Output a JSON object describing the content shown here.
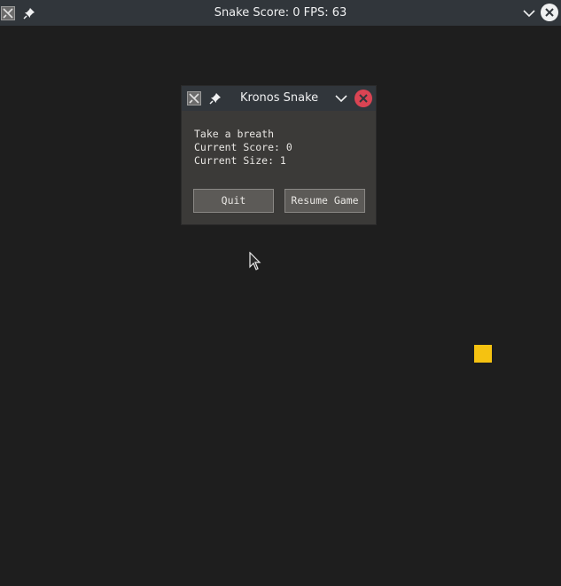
{
  "window": {
    "title": "Snake Score: 0 FPS: 63",
    "icons": [
      "app-icon",
      "pin-icon",
      "chevron-down-icon",
      "close-icon"
    ]
  },
  "dialog": {
    "title": "Kronos Snake",
    "lines": [
      "Take a breath",
      "Current Score: 0",
      "Current Size: 1"
    ],
    "buttons": {
      "quit": "Quit",
      "resume": "Resume Game"
    },
    "icons": [
      "app-icon",
      "pin-icon",
      "chevron-down-icon",
      "close-icon"
    ]
  },
  "game": {
    "score": 0,
    "fps": 63,
    "snake_size": 1,
    "food_color": "#f5c211",
    "background_color": "#1e1e1e"
  }
}
